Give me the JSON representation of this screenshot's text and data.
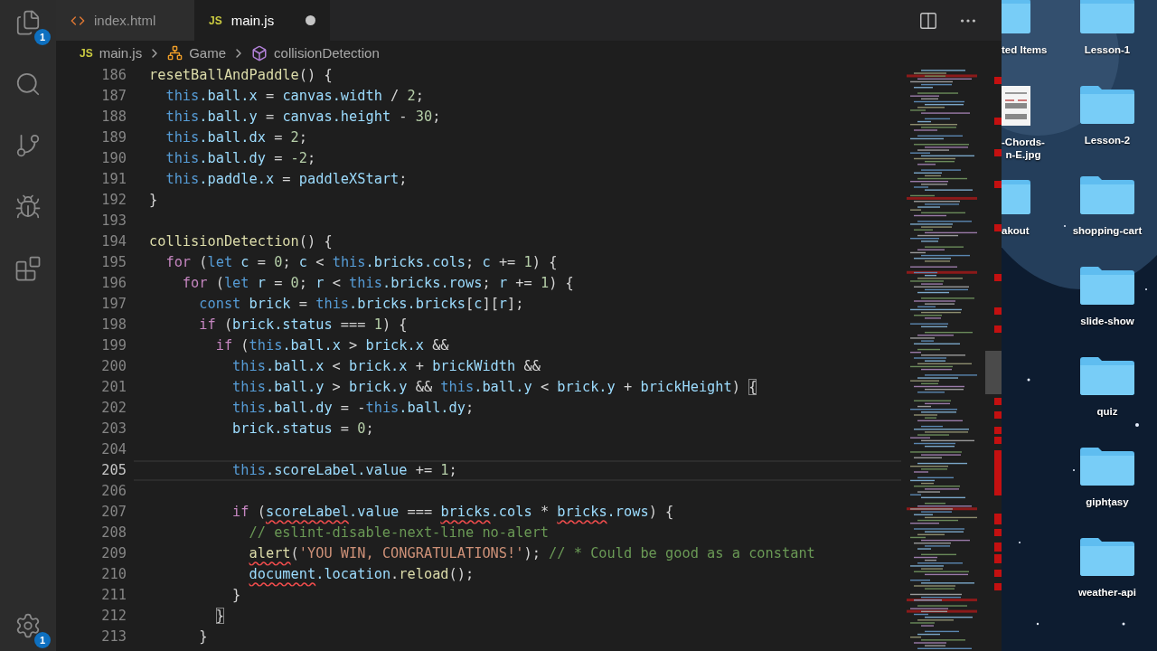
{
  "activity_bar": {
    "items": [
      {
        "kind": "explorer",
        "badge": "1"
      },
      {
        "kind": "search"
      },
      {
        "kind": "source-control"
      },
      {
        "kind": "debug"
      },
      {
        "kind": "extensions"
      }
    ],
    "bottom": {
      "kind": "settings",
      "badge": "1"
    }
  },
  "tabs": [
    {
      "kind": "html",
      "label": "index.html",
      "selected": false,
      "modified": false
    },
    {
      "kind": "js",
      "icon_text": "JS",
      "label": "main.js",
      "selected": true,
      "modified": true
    }
  ],
  "breadcrumb": [
    {
      "kind": "file",
      "icon_text": "JS",
      "label": "main.js"
    },
    {
      "kind": "class",
      "label": "Game"
    },
    {
      "kind": "method",
      "label": "collisionDetection"
    }
  ],
  "editor": {
    "lines": [
      {
        "number": "186",
        "current": false,
        "tokens": [
          {
            "kind": "fn",
            "text": "resetBallAndPaddle"
          },
          {
            "kind": "op",
            "text": "() {"
          }
        ]
      },
      {
        "number": "187",
        "current": false,
        "tokens": [
          {
            "kind": "kw",
            "text": "  this"
          },
          {
            "kind": "prop",
            "text": ".ball.x"
          },
          {
            "kind": "op",
            "text": " = "
          },
          {
            "kind": "prop",
            "text": "canvas.width"
          },
          {
            "kind": "op",
            "text": " / "
          },
          {
            "kind": "num",
            "text": "2"
          },
          {
            "kind": "op",
            "text": ";"
          }
        ]
      },
      {
        "number": "188",
        "current": false,
        "tokens": [
          {
            "kind": "kw",
            "text": "  this"
          },
          {
            "kind": "prop",
            "text": ".ball.y"
          },
          {
            "kind": "op",
            "text": " = "
          },
          {
            "kind": "prop",
            "text": "canvas.height"
          },
          {
            "kind": "op",
            "text": " - "
          },
          {
            "kind": "num",
            "text": "30"
          },
          {
            "kind": "op",
            "text": ";"
          }
        ]
      },
      {
        "number": "189",
        "current": false,
        "tokens": [
          {
            "kind": "kw",
            "text": "  this"
          },
          {
            "kind": "prop",
            "text": ".ball.dx"
          },
          {
            "kind": "op",
            "text": " = "
          },
          {
            "kind": "num",
            "text": "2"
          },
          {
            "kind": "op",
            "text": ";"
          }
        ]
      },
      {
        "number": "190",
        "current": false,
        "tokens": [
          {
            "kind": "kw",
            "text": "  this"
          },
          {
            "kind": "prop",
            "text": ".ball.dy"
          },
          {
            "kind": "op",
            "text": " = "
          },
          {
            "kind": "num",
            "text": "-2"
          },
          {
            "kind": "op",
            "text": ";"
          }
        ]
      },
      {
        "number": "191",
        "current": false,
        "tokens": [
          {
            "kind": "kw",
            "text": "  this"
          },
          {
            "kind": "prop",
            "text": ".paddle.x"
          },
          {
            "kind": "op",
            "text": " = "
          },
          {
            "kind": "prop",
            "text": "paddleXStart"
          },
          {
            "kind": "op",
            "text": ";"
          }
        ]
      },
      {
        "number": "192",
        "current": false,
        "tokens": [
          {
            "kind": "op",
            "text": "}"
          }
        ]
      },
      {
        "number": "193",
        "current": false
      },
      {
        "number": "194",
        "current": false,
        "tokens": [
          {
            "kind": "fn",
            "text": "collisionDetection"
          },
          {
            "kind": "op",
            "text": "() {"
          }
        ]
      },
      {
        "number": "195",
        "current": false,
        "tokens": [
          {
            "kind": "ctl",
            "text": "  for"
          },
          {
            "kind": "op",
            "text": " ("
          },
          {
            "kind": "kw",
            "text": "let"
          },
          {
            "kind": "prop",
            "text": " c"
          },
          {
            "kind": "op",
            "text": " = "
          },
          {
            "kind": "num",
            "text": "0"
          },
          {
            "kind": "op",
            "text": "; "
          },
          {
            "kind": "prop",
            "text": "c"
          },
          {
            "kind": "op",
            "text": " < "
          },
          {
            "kind": "kw",
            "text": "this"
          },
          {
            "kind": "prop",
            "text": ".bricks.cols"
          },
          {
            "kind": "op",
            "text": "; "
          },
          {
            "kind": "prop",
            "text": "c"
          },
          {
            "kind": "op",
            "text": " += "
          },
          {
            "kind": "num",
            "text": "1"
          },
          {
            "kind": "op",
            "text": ") {"
          }
        ]
      },
      {
        "number": "196",
        "current": false,
        "tokens": [
          {
            "kind": "ctl",
            "text": "    for"
          },
          {
            "kind": "op",
            "text": " ("
          },
          {
            "kind": "kw",
            "text": "let"
          },
          {
            "kind": "prop",
            "text": " r"
          },
          {
            "kind": "op",
            "text": " = "
          },
          {
            "kind": "num",
            "text": "0"
          },
          {
            "kind": "op",
            "text": "; "
          },
          {
            "kind": "prop",
            "text": "r"
          },
          {
            "kind": "op",
            "text": " < "
          },
          {
            "kind": "kw",
            "text": "this"
          },
          {
            "kind": "prop",
            "text": ".bricks.rows"
          },
          {
            "kind": "op",
            "text": "; "
          },
          {
            "kind": "prop",
            "text": "r"
          },
          {
            "kind": "op",
            "text": " += "
          },
          {
            "kind": "num",
            "text": "1"
          },
          {
            "kind": "op",
            "text": ") {"
          }
        ]
      },
      {
        "number": "197",
        "current": false,
        "tokens": [
          {
            "kind": "kw",
            "text": "      const"
          },
          {
            "kind": "prop",
            "text": " brick"
          },
          {
            "kind": "op",
            "text": " = "
          },
          {
            "kind": "kw",
            "text": "this"
          },
          {
            "kind": "prop",
            "text": ".bricks.bricks"
          },
          {
            "kind": "op",
            "text": "["
          },
          {
            "kind": "prop",
            "text": "c"
          },
          {
            "kind": "op",
            "text": "]["
          },
          {
            "kind": "prop",
            "text": "r"
          },
          {
            "kind": "op",
            "text": "];"
          }
        ]
      },
      {
        "number": "198",
        "current": false,
        "tokens": [
          {
            "kind": "ctl",
            "text": "      if"
          },
          {
            "kind": "op",
            "text": " ("
          },
          {
            "kind": "prop",
            "text": "brick.status"
          },
          {
            "kind": "op",
            "text": " === "
          },
          {
            "kind": "num",
            "text": "1"
          },
          {
            "kind": "op",
            "text": ") {"
          }
        ]
      },
      {
        "number": "199",
        "current": false,
        "tokens": [
          {
            "kind": "ctl",
            "text": "        if"
          },
          {
            "kind": "op",
            "text": " ("
          },
          {
            "kind": "kw",
            "text": "this"
          },
          {
            "kind": "prop",
            "text": ".ball.x"
          },
          {
            "kind": "op",
            "text": " > "
          },
          {
            "kind": "prop",
            "text": "brick.x"
          },
          {
            "kind": "op",
            "text": " &&"
          }
        ]
      },
      {
        "number": "200",
        "current": false,
        "tokens": [
          {
            "kind": "kw",
            "text": "          this"
          },
          {
            "kind": "prop",
            "text": ".ball.x"
          },
          {
            "kind": "op",
            "text": " < "
          },
          {
            "kind": "prop",
            "text": "brick.x"
          },
          {
            "kind": "op",
            "text": " + "
          },
          {
            "kind": "prop",
            "text": "brickWidth"
          },
          {
            "kind": "op",
            "text": " &&"
          }
        ]
      },
      {
        "number": "201",
        "current": false,
        "tokens": [
          {
            "kind": "kw",
            "text": "          this"
          },
          {
            "kind": "prop",
            "text": ".ball.y"
          },
          {
            "kind": "op",
            "text": " > "
          },
          {
            "kind": "prop",
            "text": "brick.y"
          },
          {
            "kind": "op",
            "text": " && "
          },
          {
            "kind": "kw",
            "text": "this"
          },
          {
            "kind": "prop",
            "text": ".ball.y"
          },
          {
            "kind": "op",
            "text": " < "
          },
          {
            "kind": "prop",
            "text": "brick.y"
          },
          {
            "kind": "op",
            "text": " + "
          },
          {
            "kind": "prop",
            "text": "brickHeight"
          },
          {
            "kind": "op",
            "text": ") "
          },
          {
            "kind": "bracket",
            "text": "{"
          }
        ]
      },
      {
        "number": "202",
        "current": false,
        "tokens": [
          {
            "kind": "kw",
            "text": "          this"
          },
          {
            "kind": "prop",
            "text": ".ball.dy"
          },
          {
            "kind": "op",
            "text": " = -"
          },
          {
            "kind": "kw",
            "text": "this"
          },
          {
            "kind": "prop",
            "text": ".ball.dy"
          },
          {
            "kind": "op",
            "text": ";"
          }
        ]
      },
      {
        "number": "203",
        "current": false,
        "tokens": [
          {
            "kind": "prop",
            "text": "          brick.status"
          },
          {
            "kind": "op",
            "text": " = "
          },
          {
            "kind": "num",
            "text": "0"
          },
          {
            "kind": "op",
            "text": ";"
          }
        ]
      },
      {
        "number": "204",
        "current": false
      },
      {
        "number": "205",
        "current": true,
        "tokens": [
          {
            "kind": "kw",
            "text": "          this"
          },
          {
            "kind": "prop",
            "text": ".scoreLabel.value"
          },
          {
            "kind": "op",
            "text": " += "
          },
          {
            "kind": "num",
            "text": "1"
          },
          {
            "kind": "op",
            "text": ";"
          }
        ]
      },
      {
        "number": "206",
        "current": false
      },
      {
        "number": "207",
        "current": false,
        "tokens": [
          {
            "kind": "ctl",
            "text": "          if"
          },
          {
            "kind": "op",
            "text": " ("
          },
          {
            "kind": "prop-err",
            "text": "scoreLabel"
          },
          {
            "kind": "prop",
            "text": ".value"
          },
          {
            "kind": "op",
            "text": " === "
          },
          {
            "kind": "prop-err",
            "text": "bricks"
          },
          {
            "kind": "prop",
            "text": ".cols"
          },
          {
            "kind": "op",
            "text": " * "
          },
          {
            "kind": "prop-err",
            "text": "bricks"
          },
          {
            "kind": "prop",
            "text": ".rows"
          },
          {
            "kind": "op",
            "text": ") {"
          }
        ]
      },
      {
        "number": "208",
        "current": false,
        "tokens": [
          {
            "kind": "cmt",
            "text": "            // eslint-disable-next-line no-alert"
          }
        ]
      },
      {
        "number": "209",
        "current": false,
        "tokens": [
          {
            "kind": "fn-err",
            "text": "            alert"
          },
          {
            "kind": "op",
            "text": "("
          },
          {
            "kind": "str",
            "text": "'YOU WIN, CONGRATULATIONS!'"
          },
          {
            "kind": "op",
            "text": "); "
          },
          {
            "kind": "cmt",
            "text": "// * Could be good as a constant"
          }
        ]
      },
      {
        "number": "210",
        "current": false,
        "tokens": [
          {
            "kind": "prop-err",
            "text": "            document"
          },
          {
            "kind": "prop",
            "text": ".location"
          },
          {
            "kind": "op",
            "text": "."
          },
          {
            "kind": "fn",
            "text": "reload"
          },
          {
            "kind": "op",
            "text": "();"
          }
        ]
      },
      {
        "number": "211",
        "current": false,
        "tokens": [
          {
            "kind": "op",
            "text": "          }"
          }
        ]
      },
      {
        "number": "212",
        "current": false,
        "tokens": [
          {
            "kind": "bracket",
            "text": "        }"
          }
        ]
      },
      {
        "number": "213",
        "current": false,
        "tokens": [
          {
            "kind": "op",
            "text": "      }"
          }
        ]
      }
    ]
  },
  "desktop": {
    "partial_column": [
      {
        "kind": "folder",
        "label_lines": [
          "ted Items"
        ]
      },
      {
        "label_lines": [
          "-Chords-",
          "n-E.jpg"
        ]
      },
      {
        "kind": "folder",
        "label_lines": [
          "akout"
        ]
      }
    ],
    "column": [
      {
        "kind": "folder",
        "label_lines": [
          "Lesson-1"
        ]
      },
      {
        "kind": "folder",
        "label_lines": [
          "Lesson-2"
        ]
      },
      {
        "kind": "folder",
        "label_lines": [
          "shopping-cart"
        ]
      },
      {
        "kind": "folder",
        "label_lines": [
          "slide-show"
        ]
      },
      {
        "kind": "folder",
        "label_lines": [
          "quiz"
        ]
      },
      {
        "kind": "folder",
        "label_lines": [
          "giphtasy"
        ]
      },
      {
        "kind": "folder",
        "label_lines": [
          "weather-api"
        ]
      }
    ]
  }
}
